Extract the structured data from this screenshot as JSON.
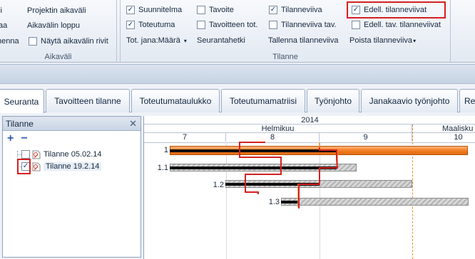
{
  "ribbon": {
    "aikavali": {
      "items": [
        "li",
        "Projektin aikaväli",
        "aa",
        "Aikavälin loppu",
        "henna",
        "Näytä aikavälin rivit"
      ],
      "label": "Aikaväli"
    },
    "tilanne": {
      "col1": {
        "suunnitelma": "Suunnitelma",
        "toteutuma": "Toteutuma",
        "tot_jana": "Tot. jana:Määrä"
      },
      "col2": {
        "tavoite": "Tavoite",
        "tavoitteen_tot": "Tavoitteen tot.",
        "seurantahetki": "Seurantahetki"
      },
      "col3": {
        "tilanneviiva": "Tilanneviiva",
        "tilanneviiva_tav": "Tilanneviiva tav.",
        "tallenna": "Tallenna tilanneviiva"
      },
      "col4": {
        "edell": "Edell. tilanneviivat",
        "edell_tav": "Edell. tav. tilanneviivat",
        "poista": "Poista tilanneviiva"
      },
      "label": "Tilanne"
    }
  },
  "tabs": [
    {
      "label": "Seuranta"
    },
    {
      "label": "Tavoitteen tilanne"
    },
    {
      "label": "Toteutumataulukko"
    },
    {
      "label": "Toteutumamatriisi"
    },
    {
      "label": "Työnjohto"
    },
    {
      "label": "Janakaavio työnjohto"
    },
    {
      "label": "Res"
    }
  ],
  "panel": {
    "title": "Tilanne",
    "close": "✕",
    "add": "+",
    "remove": "−",
    "items": [
      {
        "label": "Tilanne 05.02.14",
        "checked": false
      },
      {
        "label": "Tilanne 19.2.14",
        "checked": true
      }
    ]
  },
  "gantt": {
    "year": "2014",
    "months": [
      "Helmikuu",
      "Maalisku"
    ],
    "weeks": [
      "7",
      "8",
      "9",
      "10"
    ],
    "rows": [
      {
        "label": "1"
      },
      {
        "label": "1.1"
      },
      {
        "label": "1.2"
      },
      {
        "label": "1.3"
      }
    ]
  },
  "colors": {
    "accent_red": "#d62020",
    "bar_orange": "#f07a1e",
    "today_line": "#e8902a"
  }
}
